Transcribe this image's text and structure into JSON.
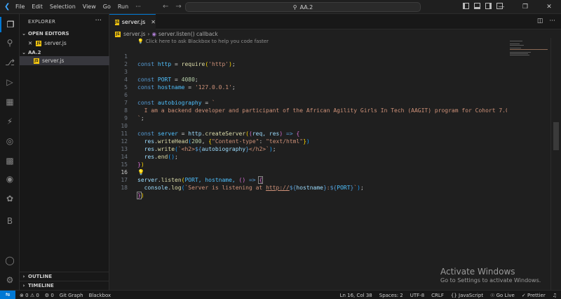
{
  "menu": [
    "File",
    "Edit",
    "Selection",
    "View",
    "Go",
    "Run"
  ],
  "menu_more": "···",
  "command_center": {
    "text": "AA.2"
  },
  "explorer": {
    "title": "EXPLORER",
    "more": "···",
    "open_editors_label": "OPEN EDITORS",
    "open_editor_file": "server.js",
    "folder_label": "AA.2",
    "folder_file": "server.js",
    "outline_label": "OUTLINE",
    "timeline_label": "TIMELINE"
  },
  "tab": {
    "label": "server.js",
    "badge": "JS"
  },
  "breadcrumb": {
    "file": "server.js",
    "symbol": "server.listen() callback"
  },
  "hint": "Click here to ask Blackbox to help you code faster",
  "line_numbers": [
    "1",
    "2",
    "3",
    "4",
    "5",
    "6",
    "7",
    "8",
    "9",
    "10",
    "11",
    "12",
    "13",
    "14",
    "15",
    "16",
    "17",
    "18"
  ],
  "code": {
    "l1_kw": "const",
    "l1_var": "http",
    "l1_op": " = ",
    "l1_fn": "require",
    "l1_str": "'http'",
    "l1_end": ";",
    "l3_kw": "const",
    "l3_var": "PORT",
    "l3_op": " = ",
    "l3_num": "4080",
    "l3_end": ";",
    "l4_kw": "const",
    "l4_var": "hostname",
    "l4_op": " = ",
    "l4_str": "'127.0.0.1'",
    "l4_end": ";",
    "l6_kw": "const",
    "l6_var": "autobiography",
    "l6_op": " = ",
    "l6_str": "`",
    "l7_str": "  I am a backend developer and participant of the African Agility Girls In Tech (AAGIT) program for Cohort 7.0.",
    "l8_str": "`",
    "l8_end": ";",
    "l10_kw": "const",
    "l10_var": "server",
    "l10_op": " = ",
    "l10_obj": "http",
    "l10_fn": "createServer",
    "l10_args": "req, res",
    "l10_arrow": " => ",
    "l11_obj": "res",
    "l11_fn": "writeHead",
    "l11_num": "200",
    "l11_key": "\"Content-type\"",
    "l11_val": "\"text/html\"",
    "l12_obj": "res",
    "l12_fn": "write",
    "l12_tag1": "<h2>",
    "l12_expr": "autobiography",
    "l12_tag2": "</h2>",
    "l13_obj": "res",
    "l13_fn": "end",
    "l16_obj": "server",
    "l16_fn": "listen",
    "l16_args": "PORT, hostname, ",
    "l16_arrow": " => ",
    "l17_obj": "console",
    "l17_fn": "log",
    "l17_str1": "`Server is listening at ",
    "l17_url": "http://",
    "l17_host": "hostname",
    "l17_port": "PORT"
  },
  "watermark": {
    "title": "Activate Windows",
    "subtitle": "Go to Settings to activate Windows."
  },
  "status": {
    "errors": "0",
    "warnings": "0",
    "ports": "0",
    "git_graph": "Git Graph",
    "blackbox": "Blackbox",
    "position": "Ln 16, Col 38",
    "spaces": "Spaces: 2",
    "encoding": "UTF-8",
    "eol": "CRLF",
    "language": "JavaScript",
    "go_live": "Go Live",
    "prettier": "Prettier"
  },
  "colors": {
    "accent": "#0078d4",
    "js_badge": "#f1c40f",
    "keyword": "#569cd6",
    "string": "#ce9178",
    "function": "#dcdcaa"
  }
}
